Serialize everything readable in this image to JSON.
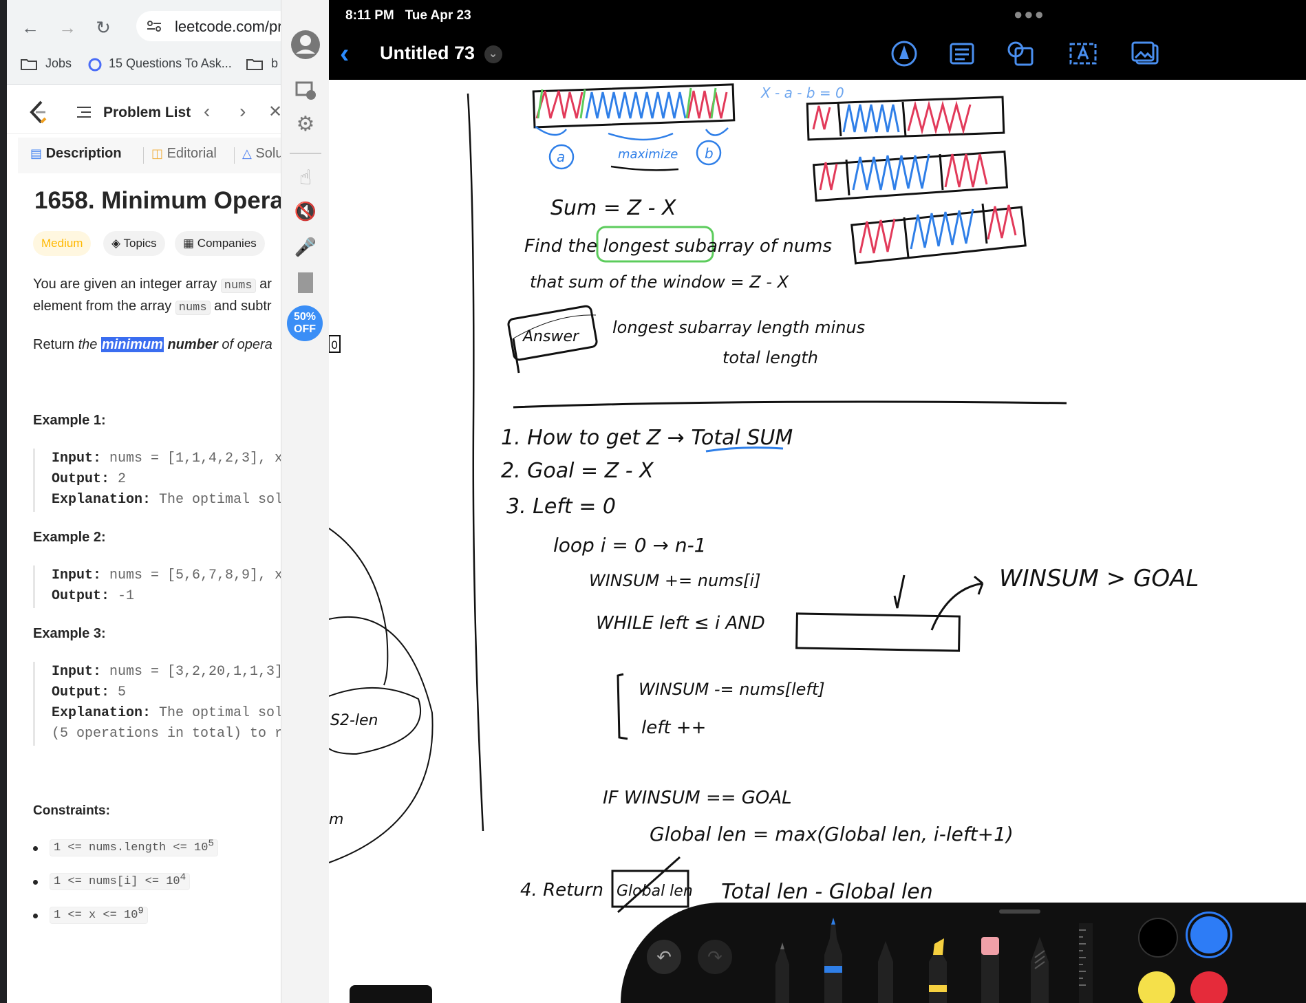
{
  "browser": {
    "url": "leetcode.com/prol",
    "bookmarks": [
      {
        "label": "Jobs",
        "icon": "folder-icon"
      },
      {
        "label": "15 Questions To Ask...",
        "icon": "site-icon"
      },
      {
        "label": "b",
        "icon": "folder-icon"
      }
    ]
  },
  "leetcode": {
    "problem_list_label": "Problem List",
    "tabs": [
      "Description",
      "Editorial",
      "Solu"
    ],
    "title": "1658. Minimum Opera",
    "difficulty": "Medium",
    "chips": [
      "Topics",
      "Companies"
    ],
    "desc_line1_a": "You are given an integer array",
    "desc_code1": "nums",
    "desc_line1_b": "ar",
    "desc_line2_a": "element from the array",
    "desc_code2": "nums",
    "desc_line2_b": "and subtr",
    "return_a": "Return",
    "return_the": "the",
    "return_min": "minimum",
    "return_number": "number",
    "return_of": "of opera",
    "examples": [
      {
        "heading": "Example 1:",
        "lines": [
          [
            "Input:",
            " nums = [1,1,4,2,3], x"
          ],
          [
            "Output:",
            " 2"
          ],
          [
            "Explanation:",
            " The optimal sol"
          ]
        ]
      },
      {
        "heading": "Example 2:",
        "lines": [
          [
            "Input:",
            " nums = [5,6,7,8,9], x"
          ],
          [
            "Output:",
            " -1"
          ]
        ]
      },
      {
        "heading": "Example 3:",
        "lines": [
          [
            "Input:",
            " nums = [3,2,20,1,1,3]"
          ],
          [
            "Output:",
            " 5"
          ],
          [
            "Explanation:",
            " The optimal sol"
          ],
          [
            "",
            "(5 operations in total) to r"
          ]
        ]
      }
    ],
    "constraints_heading": "Constraints:",
    "constraints": [
      {
        "base": "1 <= nums.length <= 10",
        "sup": "5"
      },
      {
        "base": "1 <= nums[i] <= 10",
        "sup": "4"
      },
      {
        "base": "1 <= x <= 10",
        "sup": "9"
      }
    ]
  },
  "sidebar": {
    "promo_line1": "50%",
    "promo_line2": "OFF"
  },
  "notes": {
    "status_time": "8:11 PM",
    "status_date": "Tue Apr 23",
    "doc_title": "Untitled 73",
    "handwriting": {
      "eq_top": "X - a - b = 0",
      "maximize": "maximize",
      "a": "a",
      "b": "b",
      "sum_eq": "Sum = Z - X",
      "find": "Find the longest subarray of nums",
      "that": "that sum of the window = Z - X",
      "answer": "Answer",
      "answer_text1": "longest subarray length minus",
      "answer_text2": "total length",
      "step1": "1. How to get Z → Total SUM",
      "step2": "2. Goal = Z - X",
      "step3": "3. Left = 0",
      "loop": "loop i = 0 → n-1",
      "winsum": "WINSUM += nums[i]",
      "while": "WHILE left ≤ i AND",
      "winsum_gt": "WINSUM > GOAL",
      "sub": "WINSUM -= nums[left]",
      "leftpp": "left ++",
      "if": "IF WINSUM == GOAL",
      "global": "Global len = max(Global len, i-left+1)",
      "step4": "4. Return",
      "step4_box": "Global len",
      "step4_rest": "Total len - Global len",
      "side_s2": "S2-len",
      "side_m": "m",
      "side_0": "0"
    },
    "colors": {
      "red": "#e23a5a",
      "blue": "#2f7fe8",
      "green": "#5ccc5c",
      "ink": "#111111"
    },
    "palette": [
      "#000000",
      "#2d7cf6",
      "#f5e04a",
      "#e52b3a"
    ]
  }
}
